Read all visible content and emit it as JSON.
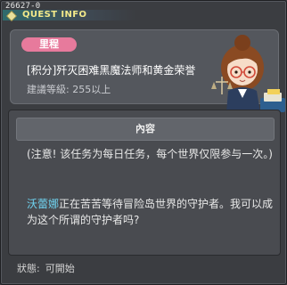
{
  "window": {
    "quest_id": "26627-0",
    "title": "QUEST INFO"
  },
  "quest": {
    "chapter_tag": "里程",
    "title": "[积分]歼灭困难黑魔法师和黄金荣誉",
    "level_requirement": "建議等級: 255以上"
  },
  "content": {
    "header": "內容",
    "notice": "(注意! 该任务为每日任务，每个世界仅限参与一次。)",
    "npc_name": "沃蕾娜",
    "description_rest": "正在苦苦等待冒险岛世界的守护者。我可以成为这个所谓的守护者吗?"
  },
  "status": {
    "label": "狀態:",
    "value": "可開始"
  },
  "colors": {
    "title_yellow": "#f2e98a",
    "tag_pink": "#e77a9c",
    "npc_name_cyan": "#6fd3f0"
  }
}
